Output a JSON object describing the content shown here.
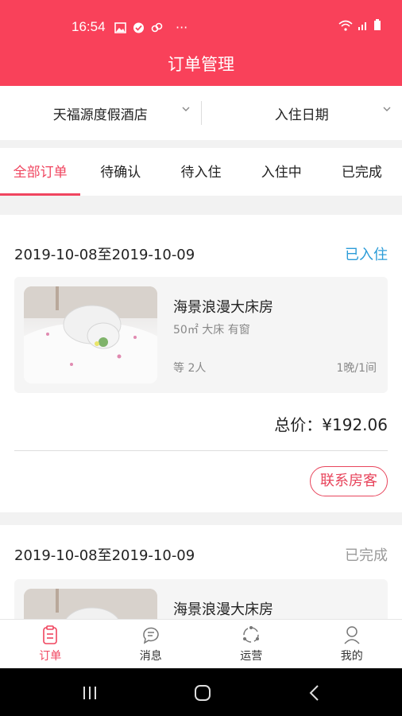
{
  "status_bar": {
    "time": "16:54",
    "ellipsis": "···"
  },
  "header": {
    "title": "订单管理"
  },
  "filters": {
    "hotel": "天福源度假酒店",
    "date": "入住日期"
  },
  "tabs": [
    "全部订单",
    "待确认",
    "待入住",
    "入住中",
    "已完成"
  ],
  "orders": [
    {
      "dates": "2019-10-08至2019-10-09",
      "status": "已入住",
      "room_name": "海景浪漫大床房",
      "room_spec": "50㎡ 大床 有窗",
      "guests": "等 2人",
      "nights": "1晚/1间",
      "total": "总价：¥192.06",
      "contact_label": "联系房客"
    },
    {
      "dates": "2019-10-08至2019-10-09",
      "status": "已完成",
      "room_name": "海景浪漫大床房"
    }
  ],
  "bottom_nav": [
    {
      "label": "订单",
      "icon": "order-clipboard-icon"
    },
    {
      "label": "消息",
      "icon": "message-bubble-icon"
    },
    {
      "label": "运营",
      "icon": "operations-cycle-icon"
    },
    {
      "label": "我的",
      "icon": "profile-person-icon"
    }
  ],
  "colors": {
    "brand": "#f9415a",
    "accent": "#f0455f",
    "link_blue": "#2b9cd8"
  }
}
